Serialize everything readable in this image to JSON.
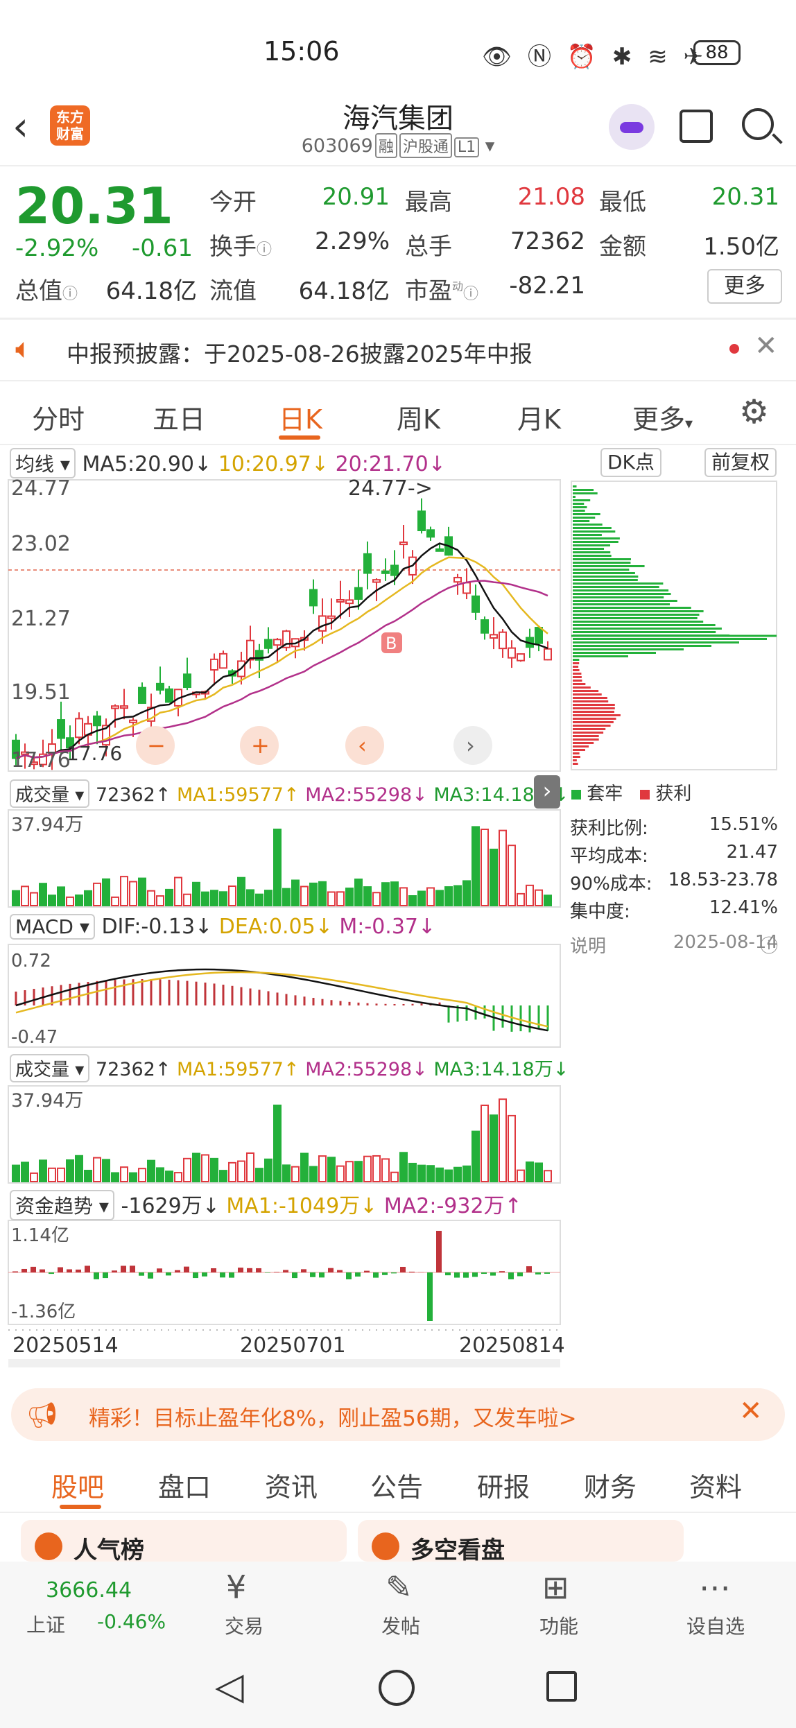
{
  "status_bar": {
    "time": "15:06",
    "battery": "88"
  },
  "header": {
    "logo_text": "东方财富",
    "title": "海汽集团",
    "code": "603069",
    "tags": [
      "融",
      "沪股通",
      "L1"
    ]
  },
  "quote": {
    "price": "20.31",
    "change_pct": "-2.92%",
    "change": "-0.61",
    "rows": [
      [
        {
          "label": "今开",
          "value": "20.91",
          "color": "green"
        },
        {
          "label": "最高",
          "value": "21.08",
          "color": "red"
        },
        {
          "label": "最低",
          "value": "20.31",
          "color": "green"
        }
      ],
      [
        {
          "label": "换手",
          "value": "2.29%",
          "color": "dark"
        },
        {
          "label": "总手",
          "value": "72362",
          "color": "dark"
        },
        {
          "label": "金额",
          "value": "1.50亿",
          "color": "dark"
        }
      ]
    ],
    "mktcap_label": "总值",
    "mktcap": "64.18亿",
    "float_label": "流值",
    "float": "64.18亿",
    "pe_label": "市盈",
    "pe_sup": "动",
    "pe": "-82.21",
    "more": "更多"
  },
  "notice": {
    "text": "中报预披露：于2025-08-26披露2025年中报"
  },
  "tabs": [
    "分时",
    "五日",
    "日K",
    "周K",
    "月K",
    "更多"
  ],
  "active_tab": "日K",
  "chart": {
    "ma_selector": "均线",
    "ma5": "MA5:20.90↓",
    "ma10": "10:20.97↓",
    "ma20": "20:21.70↓",
    "dk_button": "DK点",
    "fq_button": "前复权",
    "yticks": [
      "24.77",
      "23.02",
      "21.27",
      "19.51",
      "17.76"
    ],
    "high_marker": "24.77->",
    "low_marker": "17.76",
    "vol_selector": "成交量",
    "vol_value": "72362↑",
    "vol_ma1": "MA1:59577↑",
    "vol_ma2": "MA2:55298↓",
    "vol_ma3": "MA3:14.18万↓",
    "vol_max": "37.94万",
    "macd_selector": "MACD",
    "dif": "DIF:-0.13↓",
    "dea": "DEA:0.05↓",
    "m": "M:-0.37↓",
    "macd_max": "0.72",
    "macd_min": "-0.47",
    "flow_selector": "资金趋势",
    "flow_value": "-1629万↓",
    "flow_ma1": "MA1:-1049万↓",
    "flow_ma2": "MA2:-932万↑",
    "flow_max": "1.14亿",
    "flow_min": "-1.36亿",
    "dates": [
      "20250514",
      "20250701",
      "20250814"
    ],
    "b_marker": "B"
  },
  "chip": {
    "legend_trapped": "套牢",
    "legend_profit": "获利",
    "stats": [
      {
        "label": "获利比例:",
        "value": "15.51%"
      },
      {
        "label": "平均成本:",
        "value": "21.47"
      },
      {
        "label": "90%成本:",
        "value": "18.53-23.78"
      },
      {
        "label": "集中度:",
        "value": "12.41%"
      }
    ],
    "note_label": "说明",
    "note_date": "2025-08-14"
  },
  "ad": {
    "text": "精彩！目标止盈年化8%，刚止盈56期，又发车啦>"
  },
  "bottom_tabs": [
    "股吧",
    "盘口",
    "资讯",
    "公告",
    "研报",
    "财务",
    "资料"
  ],
  "cards": [
    "人气榜",
    "多空看盘"
  ],
  "bottom_nav": {
    "index_value": "3666.44",
    "index_name": "上证",
    "index_change": "-0.46%",
    "items": [
      "交易",
      "发帖",
      "功能",
      "设自选"
    ]
  }
}
